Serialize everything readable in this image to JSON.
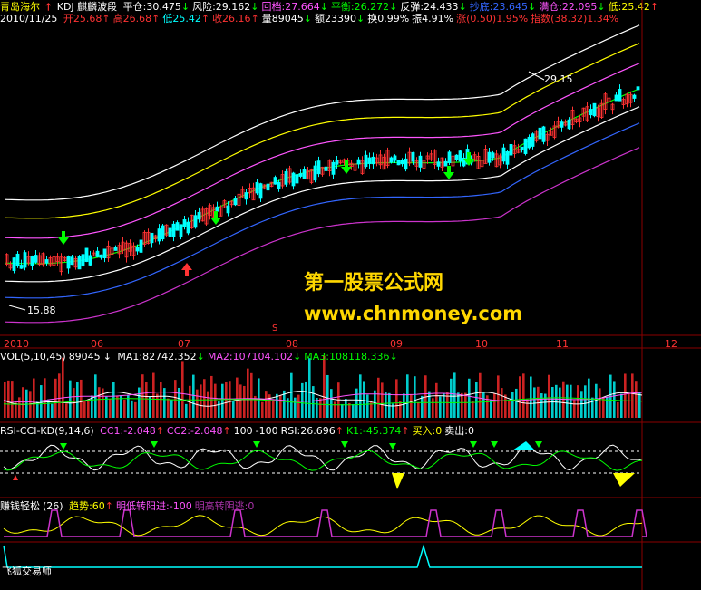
{
  "header": {
    "stock": "青岛海尔",
    "indicator": "KDJ 麒麟波段",
    "items": [
      {
        "label": "平仓:30.475",
        "arrow": "↓",
        "color": "#ffffff"
      },
      {
        "label": "风险:29.162",
        "arrow": "↓",
        "color": "#ffffff"
      },
      {
        "label": "回档:27.664",
        "arrow": "↓",
        "color": "#ff55ff"
      },
      {
        "label": "平衡:26.272",
        "arrow": "↓",
        "color": "#00ff00"
      },
      {
        "label": "反弹:24.433",
        "arrow": "↓",
        "color": "#ffffff"
      },
      {
        "label": "抄底:23.645",
        "arrow": "↓",
        "color": "#3366ff"
      },
      {
        "label": "满仓:22.095",
        "arrow": "↓",
        "color": "#ff55ff"
      },
      {
        "label": "低:25.42",
        "arrow": "↑",
        "color": "#ffff00"
      }
    ]
  },
  "quote": {
    "date": "2010/11/25",
    "items": [
      {
        "label": "开25.68",
        "arrow": "↑",
        "color": "#ff3333"
      },
      {
        "label": "高26.68",
        "arrow": "↑",
        "color": "#ff3333"
      },
      {
        "label": "低25.42",
        "arrow": "↑",
        "color": "#00ffff"
      },
      {
        "label": "收26.16",
        "arrow": "↑",
        "color": "#ff3333"
      },
      {
        "label": "量89045",
        "arrow": "↓",
        "color": "#ffffff"
      },
      {
        "label": "额23390",
        "arrow": "↓",
        "color": "#ffffff"
      },
      {
        "label": "换0.99%",
        "arrow": "",
        "color": "#ffffff"
      },
      {
        "label": "振4.91%",
        "arrow": "",
        "color": "#ffffff"
      },
      {
        "label": "涨(0.50)1.95%",
        "arrow": "",
        "color": "#ff3333"
      },
      {
        "label": "指数(38.32)1.34%",
        "arrow": "",
        "color": "#ff3333"
      }
    ]
  },
  "price_chart": {
    "high_label": "29.15",
    "low_label": "15.88",
    "s_marker": "S"
  },
  "watermark": {
    "title": "第一股票公式网",
    "url": "www.chnmoney.com"
  },
  "time_axis": {
    "labels": [
      "2010",
      "06",
      "07",
      "08",
      "09",
      "10",
      "11",
      "12"
    ]
  },
  "vol": {
    "name": "VOL(5,10,45)",
    "value": "89045",
    "items": [
      {
        "label": "MA1:82742.352",
        "arrow": "↓",
        "color": "#ffffff"
      },
      {
        "label": "MA2:107104.102",
        "arrow": "↓",
        "color": "#ff55ff"
      },
      {
        "label": "MA3:108118.336",
        "arrow": "↓",
        "color": "#00ff00"
      }
    ]
  },
  "rsi": {
    "name": "RSI-CCI-KD(9,14,6)",
    "items": [
      {
        "label": "CC1:-2.048",
        "arrow": "↑",
        "color": "#ff55ff"
      },
      {
        "label": "CC2:-2.048",
        "arrow": "↑",
        "color": "#ff55ff"
      },
      {
        "label": "100",
        "arrow": "",
        "color": "#ffffff"
      },
      {
        "label": "-100",
        "arrow": "",
        "color": "#ffffff"
      },
      {
        "label": "RSI:26.696",
        "arrow": "↑",
        "color": "#ffffff"
      },
      {
        "label": "K1:-45.374",
        "arrow": "↑",
        "color": "#00ff00"
      },
      {
        "label": "买入:0",
        "arrow": "",
        "color": "#ffff00"
      },
      {
        "label": "卖出:0",
        "arrow": "",
        "color": "#ffffff"
      }
    ]
  },
  "zqqs": {
    "name": "赚钱轻松",
    "param": "(26)",
    "items": [
      {
        "label": "趋势:60",
        "arrow": "↑",
        "color": "#ffff00"
      },
      {
        "label": "明低转阳进:-100",
        "arrow": "",
        "color": "#ff55ff"
      },
      {
        "label": "明高转阴逃:0",
        "arrow": "",
        "color": "#aa33aa"
      }
    ]
  },
  "footer": {
    "name": "飞狐交易师"
  },
  "colors": {
    "up": "#ff3333",
    "down": "#00ffff",
    "background": "#000000",
    "grid": "#8b0000"
  }
}
